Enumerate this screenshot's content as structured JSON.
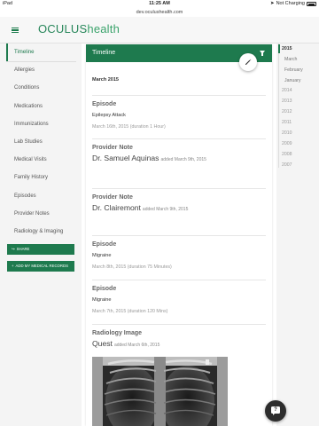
{
  "status": {
    "carrier": "iPad",
    "time": "11:25 AM",
    "charging": "Not Charging"
  },
  "browser": {
    "url": "dev.oculushealth.com"
  },
  "header": {
    "logo_part1": "OCULUS",
    "logo_part2": "health"
  },
  "sidebar": {
    "items": [
      {
        "label": "Timeline",
        "active": true
      },
      {
        "label": "Allergies"
      },
      {
        "label": "Conditions"
      },
      {
        "label": "Medications"
      },
      {
        "label": "Immunizations"
      },
      {
        "label": "Lab Studies"
      },
      {
        "label": "Medical Visits"
      },
      {
        "label": "Family History"
      },
      {
        "label": "Episodes"
      },
      {
        "label": "Provider Notes"
      },
      {
        "label": "Radiology & Imaging"
      }
    ],
    "share_label": "SHARE",
    "add_records_label": "ADD MY MEDICAL RECORDS"
  },
  "timeline": {
    "title": "Timeline",
    "month": "March 2015",
    "entries": [
      {
        "type": "Episode",
        "subtitle": "Epilepsy Attack",
        "date": "March 16th, 2015 (duration 1 Hour)"
      },
      {
        "type": "Provider Note",
        "name": "Dr. Samuel Aquinas",
        "added": "added March 9th, 2015"
      },
      {
        "type": "Provider Note",
        "name": "Dr. Clairemont",
        "added": "added March 9th, 2015"
      },
      {
        "type": "Episode",
        "subtitle": "Migraine",
        "date": "March 8th, 2015 (duration 75 Minutes)"
      },
      {
        "type": "Episode",
        "subtitle": "Migraine",
        "date": "March 7th, 2015 (duration 120 Mins)"
      },
      {
        "type": "Radiology Image",
        "name": "Quest",
        "added": "added March 6th, 2015"
      }
    ]
  },
  "years": {
    "current": "2015",
    "months": [
      "March",
      "February",
      "January"
    ],
    "list": [
      "2014",
      "2013",
      "2012",
      "2011",
      "2010",
      "2009",
      "2008",
      "2007"
    ]
  },
  "help": {
    "glyph": "?"
  },
  "colors": {
    "brand": "#1e7a4e",
    "sidebar_bg": "#f4f4f4"
  }
}
